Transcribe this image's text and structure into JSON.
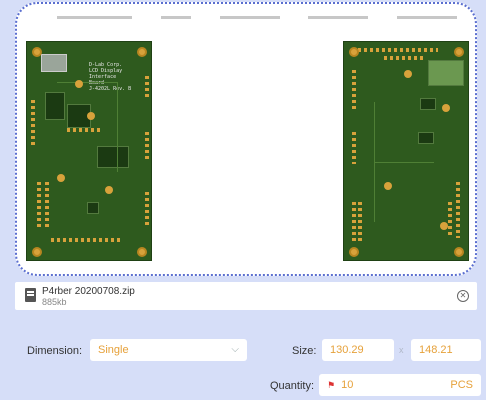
{
  "preview": {
    "front_board_silk": "D-Lab Corp.\nLCD Display\nInterface\nBoard\nJ-4202L Rev. B"
  },
  "file": {
    "name": "P4rber 20200708.zip",
    "size": "885kb",
    "remove_icon": "close-circle-icon"
  },
  "form": {
    "dimension_label": "Dimension:",
    "dimension_value": "Single",
    "size_label": "Size:",
    "size_width": "130.29",
    "size_sep": "x",
    "size_height": "148.21",
    "quantity_label": "Quantity:",
    "quantity_value": "10",
    "quantity_unit": "PCS"
  },
  "colors": {
    "background": "#d6def8",
    "accent": "#e6a13a",
    "pcb_green": "#2e5a1e",
    "pad_gold": "#d8a23b"
  }
}
